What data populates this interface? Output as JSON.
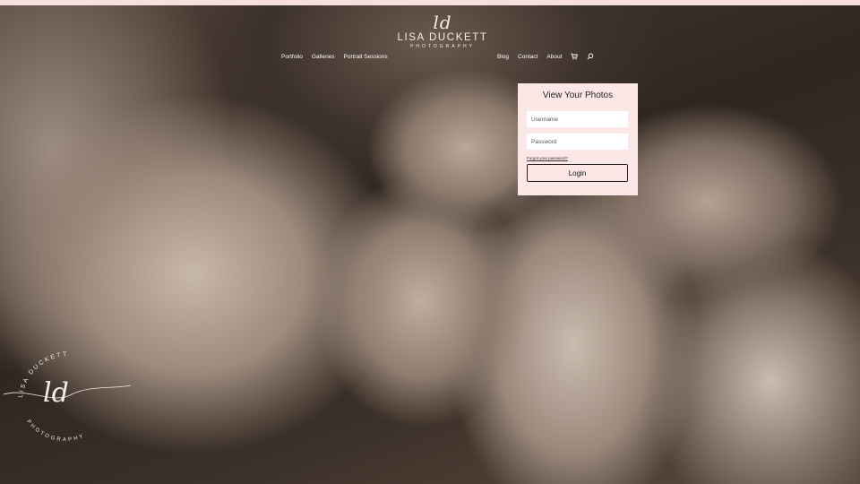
{
  "brand": {
    "monogram": "ld",
    "name": "LISA DUCKETT",
    "tagline": "PHOTOGRAPHY"
  },
  "nav": {
    "left": [
      "Portfolio",
      "Galleries",
      "Portrait Sessions"
    ],
    "right": [
      "Blog",
      "Contact",
      "About"
    ],
    "cart_icon": "cart-icon",
    "search_icon": "search-icon"
  },
  "login": {
    "title": "View Your Photos",
    "username_placeholder": "Username",
    "password_placeholder": "Password",
    "forgot_label": "Forgot your password?",
    "button_label": "Login"
  },
  "watermark": {
    "top_text": "LISA DUCKETT",
    "bottom_text": "PHOTOGRAPHY",
    "monogram": "ld"
  },
  "colors": {
    "card_bg": "#fbe8e6",
    "accent_strip": "#f6e0de",
    "nav_text": "#ffffff"
  }
}
